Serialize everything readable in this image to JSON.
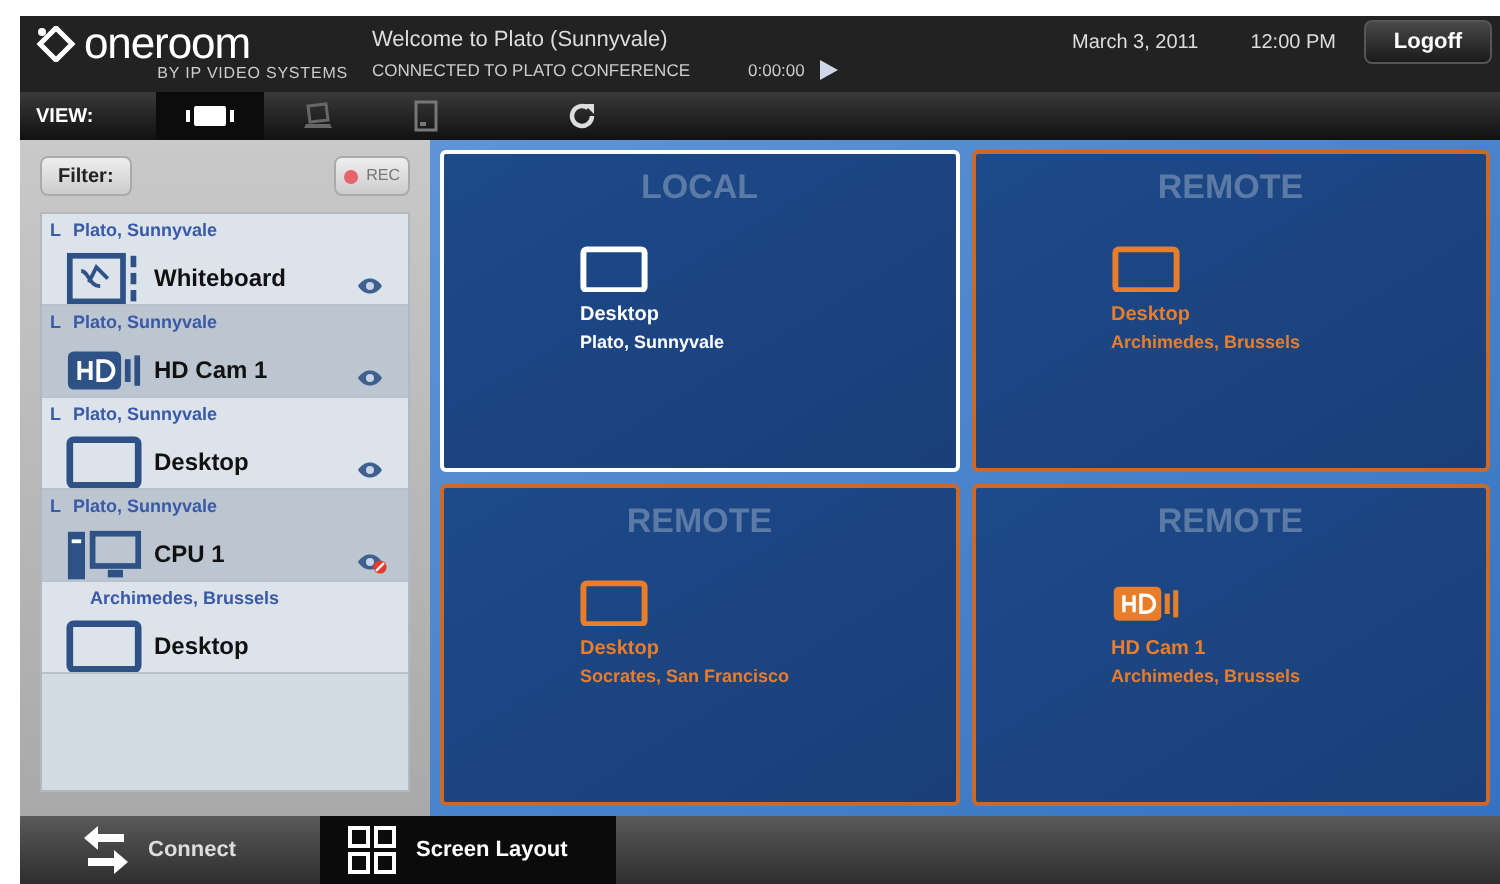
{
  "header": {
    "logo": "oneroom",
    "logo_sub": "BY IP VIDEO SYSTEMS",
    "welcome": "Welcome to Plato (Sunnyvale)",
    "status": "CONNECTED TO PLATO CONFERENCE",
    "timer": "0:00:00",
    "date": "March 3, 2011",
    "time": "12:00 PM",
    "logoff": "Logoff"
  },
  "view_bar": {
    "label": "VIEW:",
    "tabs": [
      {
        "kind": "layout",
        "selected": true
      },
      {
        "kind": "laptop",
        "selected": false
      },
      {
        "kind": "tablet",
        "selected": false
      },
      {
        "kind": "refresh",
        "selected": false
      }
    ]
  },
  "sidebar": {
    "filter": "Filter:",
    "rec": "REC",
    "items": [
      {
        "marker": "L",
        "location": "Plato, Sunnyvale",
        "kind": "whiteboard",
        "name": "Whiteboard",
        "blocked": false
      },
      {
        "marker": "L",
        "location": "Plato, Sunnyvale",
        "kind": "hdcam",
        "name": "HD Cam 1",
        "blocked": false
      },
      {
        "marker": "L",
        "location": "Plato, Sunnyvale",
        "kind": "desktop",
        "name": "Desktop",
        "blocked": false
      },
      {
        "marker": "L",
        "location": "Plato, Sunnyvale",
        "kind": "cpu",
        "name": "CPU 1",
        "blocked": true
      },
      {
        "location": "Archimedes, Brussels",
        "kind": "desktop",
        "name": "Desktop"
      }
    ]
  },
  "tiles": [
    {
      "label": "LOCAL",
      "kind": "desktop",
      "name": "Desktop",
      "location": "Plato, Sunnyvale",
      "selected": true
    },
    {
      "label": "REMOTE",
      "kind": "desktop",
      "name": "Desktop",
      "location": "Archimedes, Brussels",
      "selected": false
    },
    {
      "label": "REMOTE",
      "kind": "desktop",
      "name": "Desktop",
      "location": "Socrates, San Francisco",
      "selected": false
    },
    {
      "label": "REMOTE",
      "kind": "hdcam",
      "name": "HD Cam 1",
      "location": "Archimedes, Brussels",
      "selected": false
    }
  ],
  "bottom_tabs": [
    {
      "kind": "connect",
      "label": "Connect",
      "selected": false
    },
    {
      "kind": "layout",
      "label": "Screen Layout",
      "selected": true
    }
  ]
}
